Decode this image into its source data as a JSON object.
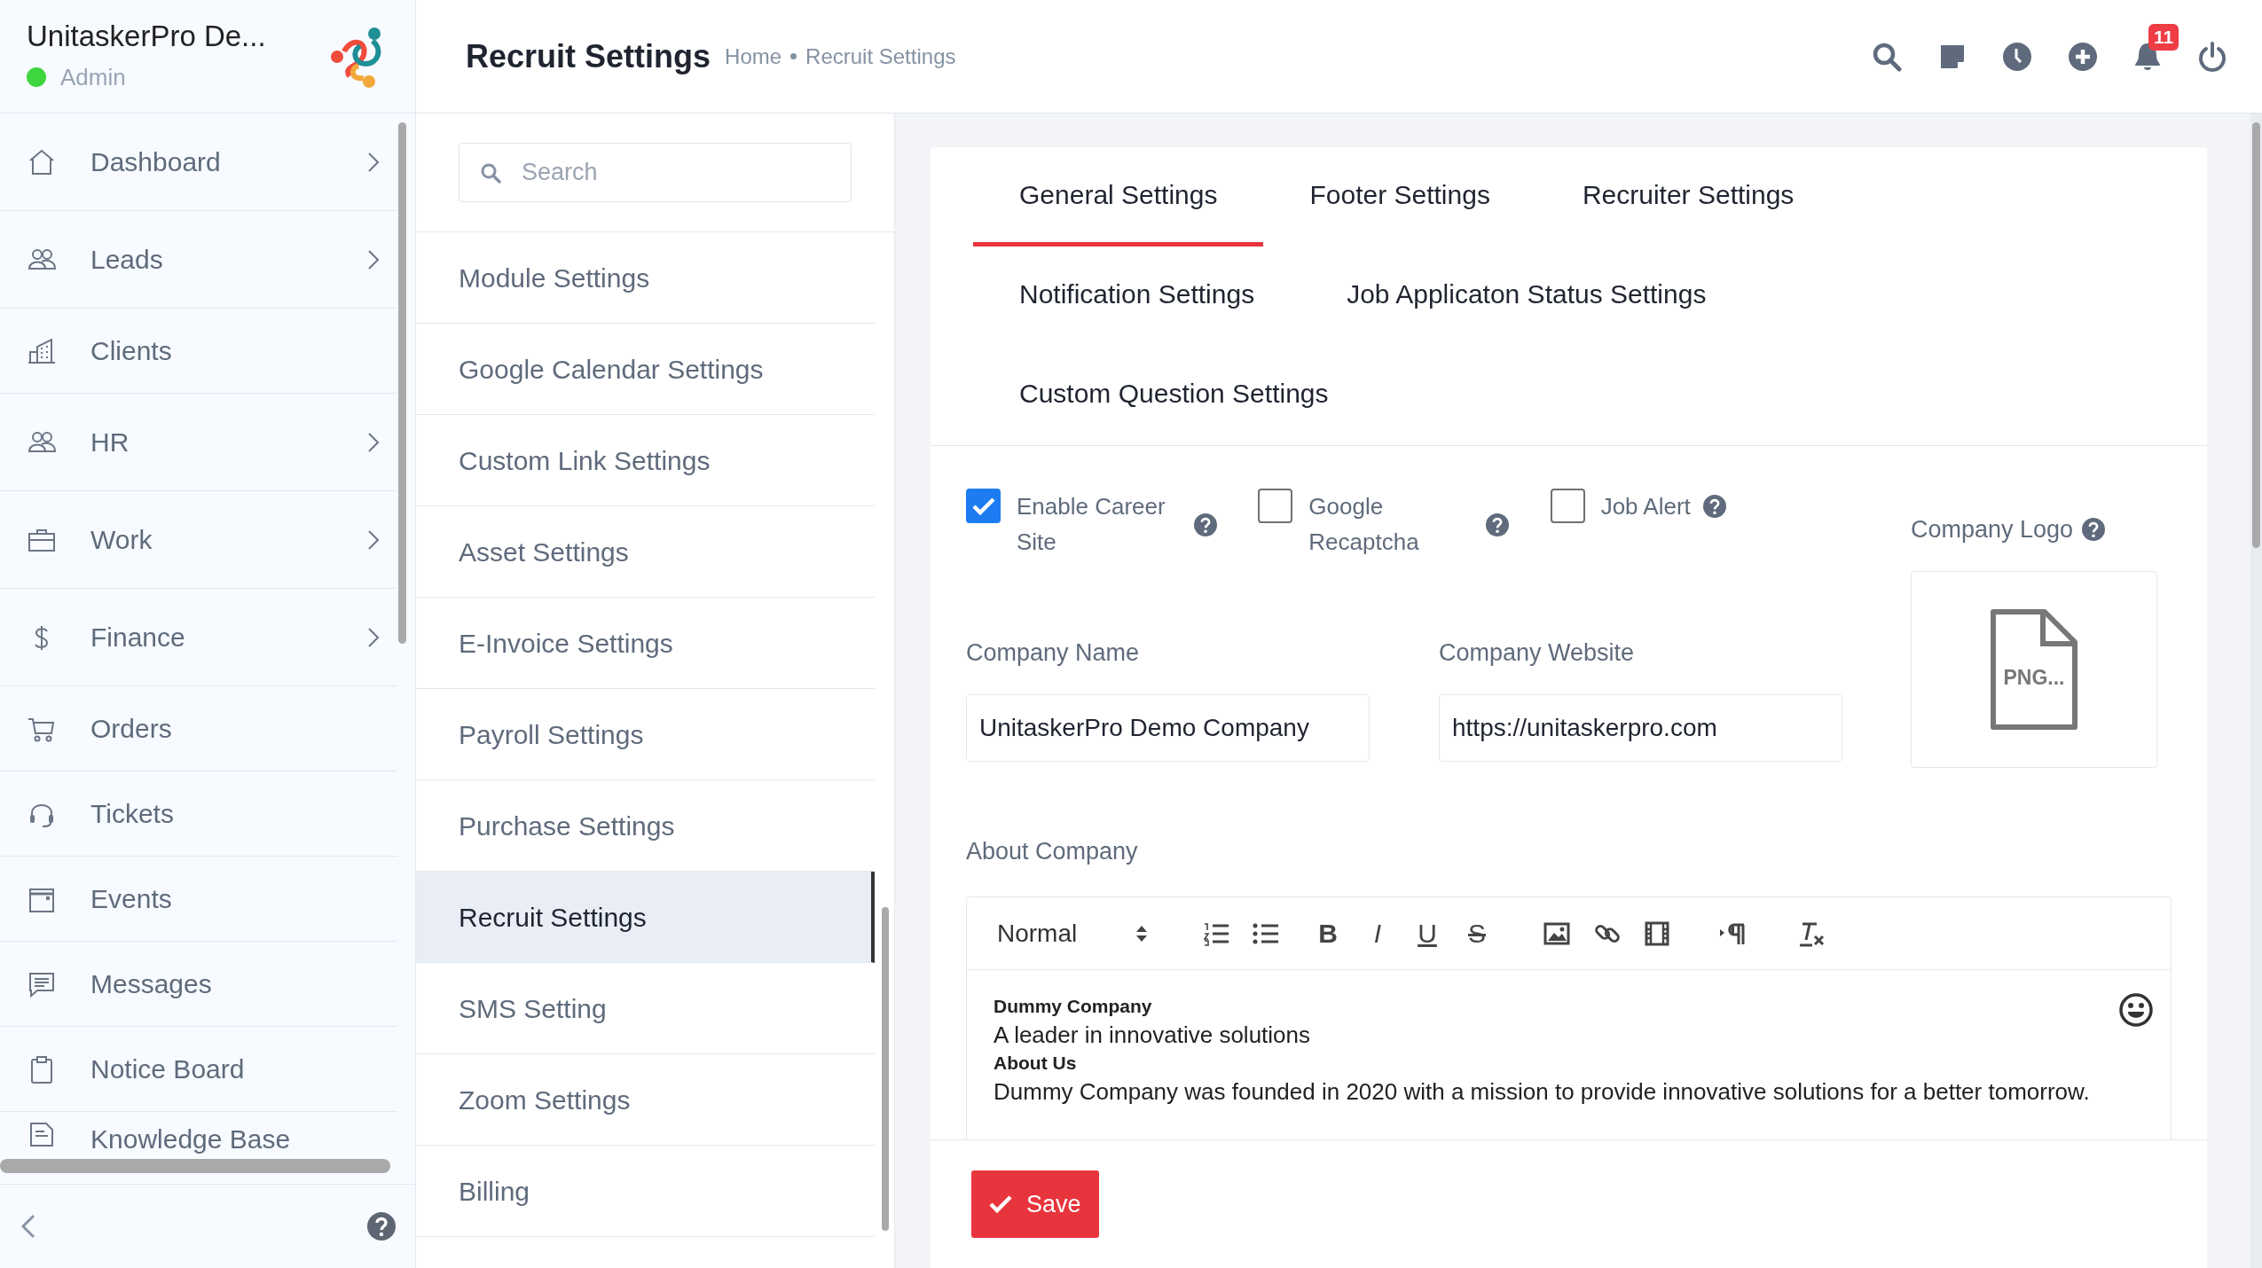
{
  "sidebar": {
    "title": "UnitaskerPro De...",
    "role": "Admin",
    "online": true,
    "items": [
      {
        "label": "Dashboard",
        "has_submenu": true
      },
      {
        "label": "Leads",
        "has_submenu": true
      },
      {
        "label": "Clients",
        "has_submenu": false
      },
      {
        "label": "HR",
        "has_submenu": true
      },
      {
        "label": "Work",
        "has_submenu": true
      },
      {
        "label": "Finance",
        "has_submenu": true
      },
      {
        "label": "Orders",
        "has_submenu": false
      },
      {
        "label": "Tickets",
        "has_submenu": false
      },
      {
        "label": "Events",
        "has_submenu": false
      },
      {
        "label": "Messages",
        "has_submenu": false
      },
      {
        "label": "Notice Board",
        "has_submenu": false
      },
      {
        "label": "Knowledge Base",
        "has_submenu": false
      }
    ]
  },
  "header": {
    "title": "Recruit Settings",
    "breadcrumb": [
      "Home",
      "Recruit Settings"
    ],
    "notification_count": "11"
  },
  "settings_menu": {
    "search": {
      "placeholder": "Search"
    },
    "items": [
      {
        "label": "Module Settings",
        "selected": false
      },
      {
        "label": "Google Calendar Settings",
        "selected": false
      },
      {
        "label": "Custom Link Settings",
        "selected": false
      },
      {
        "label": "Asset Settings",
        "selected": false
      },
      {
        "label": "E-Invoice Settings",
        "selected": false
      },
      {
        "label": "Payroll Settings",
        "selected": false
      },
      {
        "label": "Purchase Settings",
        "selected": false
      },
      {
        "label": "Recruit Settings",
        "selected": true
      },
      {
        "label": "SMS Setting",
        "selected": false
      },
      {
        "label": "Zoom Settings",
        "selected": false
      },
      {
        "label": "Billing",
        "selected": false
      }
    ]
  },
  "tab_rows": [
    [
      {
        "label": "General Settings",
        "selected": true
      },
      {
        "label": "Footer Settings",
        "selected": false
      },
      {
        "label": "Recruiter Settings",
        "selected": false
      }
    ],
    [
      {
        "label": "Notification Settings",
        "selected": false
      },
      {
        "label": "Job Applicaton Status Settings",
        "selected": false
      }
    ],
    [
      {
        "label": "Custom Question Settings",
        "selected": false
      }
    ]
  ],
  "checkboxes": [
    {
      "label": "Enable Career Site",
      "checked": true
    },
    {
      "label": "Google Recaptcha",
      "checked": false
    },
    {
      "label": "Job Alert",
      "checked": false
    }
  ],
  "fields": [
    {
      "label": "Company Name",
      "value": "UnitaskerPro Demo Company"
    },
    {
      "label": "Company Website",
      "value": "https://unitaskerpro.com"
    }
  ],
  "logo": {
    "label": "Company Logo",
    "file_label": "PNG..."
  },
  "about": {
    "label": "About Company",
    "format": "Normal",
    "glyph_buttons": [
      "B",
      "I",
      "U",
      "S"
    ],
    "content": [
      {
        "kind": "heading",
        "text": "Dummy Company"
      },
      {
        "kind": "paragraph",
        "text": "A leader in innovative solutions"
      },
      {
        "kind": "heading",
        "text": "About Us"
      },
      {
        "kind": "paragraph",
        "text": "Dummy Company was founded in 2020 with a mission to provide innovative solutions for a better tomorrow."
      }
    ]
  },
  "save_button": "Save"
}
